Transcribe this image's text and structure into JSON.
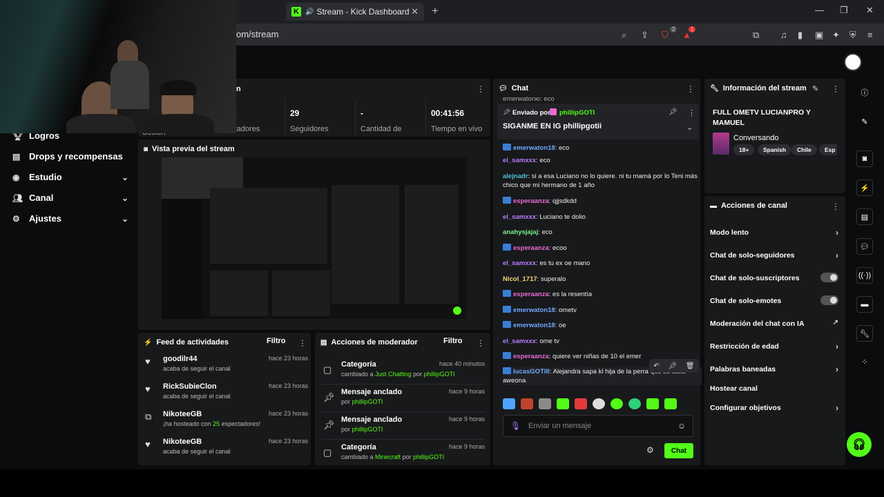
{
  "browser": {
    "tab_title": "Stream - Kick Dashboard",
    "tab_favicon": "K",
    "url_fragment": "om/stream",
    "brave_badge": "2",
    "alert_badge": "1"
  },
  "nav": {
    "items": [
      {
        "label": "Logros",
        "icon": "trophy-icon"
      },
      {
        "label": "Drops y recompensas",
        "icon": "gift-icon"
      },
      {
        "label": "Estudio",
        "icon": "gear-icon"
      },
      {
        "label": "Canal",
        "icon": "users-icon"
      },
      {
        "label": "Ajustes",
        "icon": "gear-icon"
      }
    ]
  },
  "session": {
    "title_fragment": "n",
    "session_label_fragment": "Sesión",
    "viewers_label_fragment": "ectadores",
    "followers_value": "29",
    "followers_label": "Seguidores",
    "quantity_value": "-",
    "quantity_label": "Cantidad de",
    "time_value": "00:41:56",
    "time_label": "Tiempo en vivo"
  },
  "preview": {
    "title": "Vista previa del stream"
  },
  "activity": {
    "title": "Feed de actividades",
    "filter_label": "Filtro",
    "items": [
      {
        "name": "goodilr44",
        "time": "hace 23 horas",
        "sub": "acaba de seguir el canal"
      },
      {
        "name": "RickSubieClon",
        "time": "hace 23 horas",
        "sub": "acaba de seguir el canal"
      },
      {
        "name": "NikoteeGB",
        "time": "hace 23 horas",
        "sub_a": "¡ha hosteado con ",
        "sub_b": "25",
        "sub_c": " espectadores!"
      },
      {
        "name": "NikoteeGB",
        "time": "hace 23 horas",
        "sub": "acaba de seguir el canal"
      }
    ]
  },
  "moderator": {
    "title": "Acciones de moderador",
    "filter_label": "Filtro",
    "items": [
      {
        "title": "Categoría",
        "time": "hace 40 minutos",
        "sub_a": "cambiado a ",
        "sub_b": "Just Chatting",
        "sub_c": " por ",
        "sub_d": "phillipGOTI"
      },
      {
        "title": "Mensaje anclado",
        "time": "hace 9 horas",
        "sub_a": "por ",
        "sub_b": "phillipGOTI"
      },
      {
        "title": "Mensaje anclado",
        "time": "hace 9 horas",
        "sub_a": "por ",
        "sub_b": "phillipGOTI"
      },
      {
        "title": "Categoría",
        "time": "hace 9 horas",
        "sub_a": "cambiado a ",
        "sub_b": "Minecraft",
        "sub_c": " por ",
        "sub_d": "phillipGOTI"
      }
    ]
  },
  "chat": {
    "title": "Chat",
    "top_fragment": "emerwatonю: eco",
    "pinned_by_label": "Enviado por",
    "pinned_by_user": "phillipGOTI",
    "pinned_text": "SIGANME EN IG phillipgotii",
    "messages": [
      {
        "user": "emerwaton18",
        "color": "#6fa8ff",
        "badge": true,
        "text": "eco"
      },
      {
        "user": "el_samxxx",
        "color": "#b67cff",
        "badge": false,
        "text": "eco"
      },
      {
        "user": "alejnadr",
        "color": "#4fc3d9",
        "badge": false,
        "text": "si a esa Luciano no lo quiere. ni tu mamá por lo Teni más chico que mi hermano de 1 año"
      },
      {
        "user": "esperaanza",
        "color": "#e96bd4",
        "badge": true,
        "text": "qjjsdkdd"
      },
      {
        "user": "el_samxxx",
        "color": "#b67cff",
        "badge": false,
        "text": "Luciano te dolio"
      },
      {
        "user": "anahysjajaj",
        "color": "#7ef08f",
        "badge": false,
        "text": "eco"
      },
      {
        "user": "esperaanza",
        "color": "#e96bd4",
        "badge": true,
        "text": "ecoo"
      },
      {
        "user": "el_samxxx",
        "color": "#b67cff",
        "badge": false,
        "text": "es tu ex oe mano"
      },
      {
        "user": "Nicol_1717",
        "color": "#f5d67a",
        "badge": false,
        "text": "superalo"
      },
      {
        "user": "esperaanza",
        "color": "#e96bd4",
        "badge": true,
        "text": "es la resentía"
      },
      {
        "user": "emerwaton18",
        "color": "#6fa8ff",
        "badge": true,
        "text": "ometv"
      },
      {
        "user": "emerwaton18",
        "color": "#6fa8ff",
        "badge": true,
        "text": "oe"
      },
      {
        "user": "el_samxxx",
        "color": "#b67cff",
        "badge": false,
        "text": "ome tv"
      },
      {
        "user": "esperaanza",
        "color": "#e96bd4",
        "badge": true,
        "text": "quiere ver niñas de 10 el emer"
      },
      {
        "user": "lucasGOTIII",
        "color": "#6fa8ff",
        "badge": true,
        "text": "Alejandra sapa kl hija de la perra que se calla aweona"
      }
    ],
    "input_placeholder": "Enviar un mensaje",
    "send_label": "Chat"
  },
  "info": {
    "title": "Información del stream",
    "stream_title": "FULL OMETV LUCIANPRO Y MAMUEL",
    "category": "Conversando",
    "tags": [
      "18+",
      "Spanish",
      "Chile",
      "Esp"
    ]
  },
  "channel_actions": {
    "title": "Acciones de canal",
    "items": [
      {
        "label": "Modo lento",
        "control": "chevron"
      },
      {
        "label": "Chat de solo-seguidores",
        "control": "chevron"
      },
      {
        "label": "Chat de solo-suscriptores",
        "control": "toggle"
      },
      {
        "label": "Chat de solo-emotes",
        "control": "toggle"
      },
      {
        "label": "Moderación del chat con IA",
        "control": "external"
      },
      {
        "label": "Restricción de edad",
        "control": "chevron"
      },
      {
        "label": "Palabras baneadas",
        "control": "chevron"
      },
      {
        "label": "Hostear canal",
        "control": "none"
      },
      {
        "label": "Configurar objetivos",
        "control": "chevron"
      }
    ]
  },
  "colors": {
    "accent": "#53fc18",
    "panel": "#18191b",
    "bg": "#0b0c0d"
  }
}
